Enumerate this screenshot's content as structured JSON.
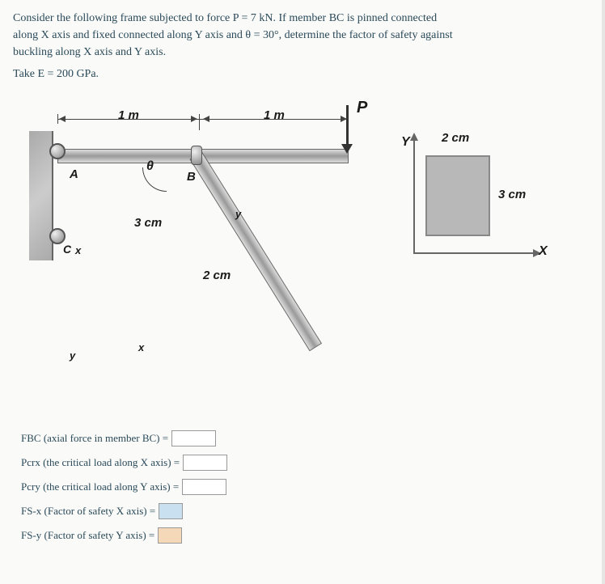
{
  "problem": {
    "line1": "Consider the following frame subjected to force P = 7 kN. If member BC is pinned connected",
    "line2": "along X axis and fixed connected along Y axis and θ = 30°, determine the factor of safety against",
    "line3": "buckling along X axis and Y axis.",
    "line4": "Take E = 200 GPa."
  },
  "diagram": {
    "force_label": "P",
    "dim_1m_left": "1 m",
    "dim_1m_right": "1 m",
    "theta": "θ",
    "label_A": "A",
    "label_B": "B",
    "label_C": "C",
    "label_x": "x",
    "label_y": "y",
    "dim_3cm_bc": "3 cm",
    "dim_2cm_bc": "2 cm"
  },
  "cross_section": {
    "width": "2 cm",
    "height": "3 cm",
    "axis_x": "X",
    "axis_y": "Y"
  },
  "answers": {
    "fbc_label": "FBC (axial force in member BC) =",
    "pcrx_label": "Pcrx (the critical load along X axis) =",
    "pcry_label": "Pcry (the critical load along Y axis) =",
    "fsx_label": "FS-x (Factor of safety X axis) =",
    "fsy_label": "FS-y (Factor of safety Y axis) ="
  }
}
